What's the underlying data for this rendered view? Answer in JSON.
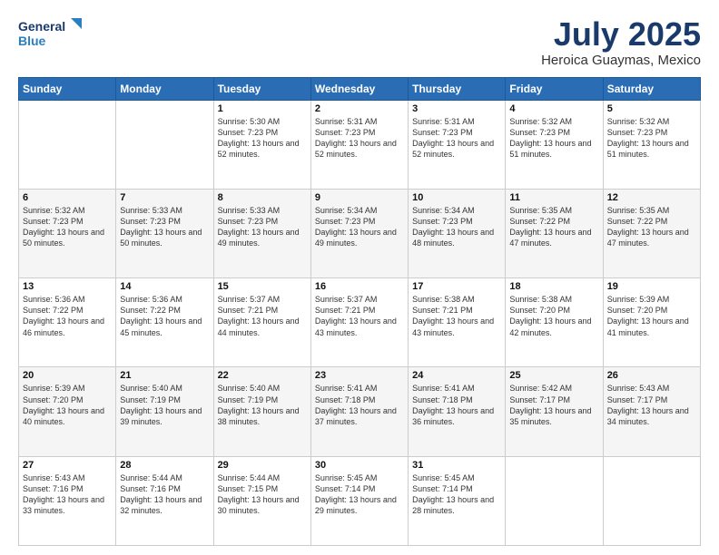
{
  "header": {
    "logo_line1": "General",
    "logo_line2": "Blue",
    "main_title": "July 2025",
    "subtitle": "Heroica Guaymas, Mexico"
  },
  "days_of_week": [
    "Sunday",
    "Monday",
    "Tuesday",
    "Wednesday",
    "Thursday",
    "Friday",
    "Saturday"
  ],
  "weeks": [
    [
      {
        "day": "",
        "content": ""
      },
      {
        "day": "",
        "content": ""
      },
      {
        "day": "1",
        "content": "Sunrise: 5:30 AM\nSunset: 7:23 PM\nDaylight: 13 hours and 52 minutes."
      },
      {
        "day": "2",
        "content": "Sunrise: 5:31 AM\nSunset: 7:23 PM\nDaylight: 13 hours and 52 minutes."
      },
      {
        "day": "3",
        "content": "Sunrise: 5:31 AM\nSunset: 7:23 PM\nDaylight: 13 hours and 52 minutes."
      },
      {
        "day": "4",
        "content": "Sunrise: 5:32 AM\nSunset: 7:23 PM\nDaylight: 13 hours and 51 minutes."
      },
      {
        "day": "5",
        "content": "Sunrise: 5:32 AM\nSunset: 7:23 PM\nDaylight: 13 hours and 51 minutes."
      }
    ],
    [
      {
        "day": "6",
        "content": "Sunrise: 5:32 AM\nSunset: 7:23 PM\nDaylight: 13 hours and 50 minutes."
      },
      {
        "day": "7",
        "content": "Sunrise: 5:33 AM\nSunset: 7:23 PM\nDaylight: 13 hours and 50 minutes."
      },
      {
        "day": "8",
        "content": "Sunrise: 5:33 AM\nSunset: 7:23 PM\nDaylight: 13 hours and 49 minutes."
      },
      {
        "day": "9",
        "content": "Sunrise: 5:34 AM\nSunset: 7:23 PM\nDaylight: 13 hours and 49 minutes."
      },
      {
        "day": "10",
        "content": "Sunrise: 5:34 AM\nSunset: 7:23 PM\nDaylight: 13 hours and 48 minutes."
      },
      {
        "day": "11",
        "content": "Sunrise: 5:35 AM\nSunset: 7:22 PM\nDaylight: 13 hours and 47 minutes."
      },
      {
        "day": "12",
        "content": "Sunrise: 5:35 AM\nSunset: 7:22 PM\nDaylight: 13 hours and 47 minutes."
      }
    ],
    [
      {
        "day": "13",
        "content": "Sunrise: 5:36 AM\nSunset: 7:22 PM\nDaylight: 13 hours and 46 minutes."
      },
      {
        "day": "14",
        "content": "Sunrise: 5:36 AM\nSunset: 7:22 PM\nDaylight: 13 hours and 45 minutes."
      },
      {
        "day": "15",
        "content": "Sunrise: 5:37 AM\nSunset: 7:21 PM\nDaylight: 13 hours and 44 minutes."
      },
      {
        "day": "16",
        "content": "Sunrise: 5:37 AM\nSunset: 7:21 PM\nDaylight: 13 hours and 43 minutes."
      },
      {
        "day": "17",
        "content": "Sunrise: 5:38 AM\nSunset: 7:21 PM\nDaylight: 13 hours and 43 minutes."
      },
      {
        "day": "18",
        "content": "Sunrise: 5:38 AM\nSunset: 7:20 PM\nDaylight: 13 hours and 42 minutes."
      },
      {
        "day": "19",
        "content": "Sunrise: 5:39 AM\nSunset: 7:20 PM\nDaylight: 13 hours and 41 minutes."
      }
    ],
    [
      {
        "day": "20",
        "content": "Sunrise: 5:39 AM\nSunset: 7:20 PM\nDaylight: 13 hours and 40 minutes."
      },
      {
        "day": "21",
        "content": "Sunrise: 5:40 AM\nSunset: 7:19 PM\nDaylight: 13 hours and 39 minutes."
      },
      {
        "day": "22",
        "content": "Sunrise: 5:40 AM\nSunset: 7:19 PM\nDaylight: 13 hours and 38 minutes."
      },
      {
        "day": "23",
        "content": "Sunrise: 5:41 AM\nSunset: 7:18 PM\nDaylight: 13 hours and 37 minutes."
      },
      {
        "day": "24",
        "content": "Sunrise: 5:41 AM\nSunset: 7:18 PM\nDaylight: 13 hours and 36 minutes."
      },
      {
        "day": "25",
        "content": "Sunrise: 5:42 AM\nSunset: 7:17 PM\nDaylight: 13 hours and 35 minutes."
      },
      {
        "day": "26",
        "content": "Sunrise: 5:43 AM\nSunset: 7:17 PM\nDaylight: 13 hours and 34 minutes."
      }
    ],
    [
      {
        "day": "27",
        "content": "Sunrise: 5:43 AM\nSunset: 7:16 PM\nDaylight: 13 hours and 33 minutes."
      },
      {
        "day": "28",
        "content": "Sunrise: 5:44 AM\nSunset: 7:16 PM\nDaylight: 13 hours and 32 minutes."
      },
      {
        "day": "29",
        "content": "Sunrise: 5:44 AM\nSunset: 7:15 PM\nDaylight: 13 hours and 30 minutes."
      },
      {
        "day": "30",
        "content": "Sunrise: 5:45 AM\nSunset: 7:14 PM\nDaylight: 13 hours and 29 minutes."
      },
      {
        "day": "31",
        "content": "Sunrise: 5:45 AM\nSunset: 7:14 PM\nDaylight: 13 hours and 28 minutes."
      },
      {
        "day": "",
        "content": ""
      },
      {
        "day": "",
        "content": ""
      }
    ]
  ]
}
